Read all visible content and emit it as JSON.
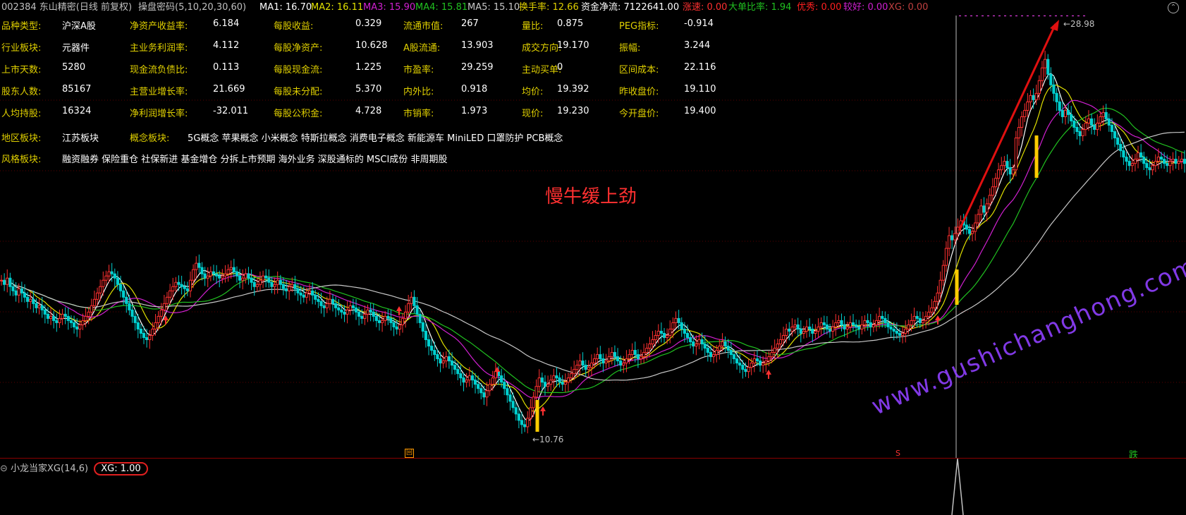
{
  "header": {
    "stock": "002384 东山精密(日线 前复权)",
    "indicator_name": "操盘密码(5,10,20,30,60)",
    "ma1": "MA1: 16.70",
    "ma2": "MA2: 16.11",
    "ma3": "MA3: 15.90",
    "ma4": "MA4: 15.81",
    "ma5": "MA5: 15.10",
    "turnover": "换手率: 12.66",
    "fund_flow": "资金净流: 7122641.00",
    "speed": "涨速: 0.00",
    "big_ratio": "大单比率: 1.94",
    "excellent": "优秀: 0.00",
    "good": "较好: 0.00",
    "xg": "XG: 0.00"
  },
  "info_rows": [
    [
      {
        "label": "品种类型:",
        "value": "沪深A股"
      },
      {
        "label": "净资产收益率:",
        "value": "6.184"
      },
      {
        "label": "每股收益:",
        "value": "0.329"
      },
      {
        "label": "流通市值:",
        "value": "267"
      },
      {
        "label": "量比:",
        "value": "0.875"
      },
      {
        "label": "PEG指标:",
        "value": "-0.914"
      }
    ],
    [
      {
        "label": "行业板块:",
        "value": "元器件"
      },
      {
        "label": "主业务利润率:",
        "value": "4.112"
      },
      {
        "label": "每股净资产:",
        "value": "10.628"
      },
      {
        "label": "A股流通:",
        "value": "13.903"
      },
      {
        "label": "成交方向:",
        "value": "19.170"
      },
      {
        "label": "振幅:",
        "value": "3.244"
      }
    ],
    [
      {
        "label": "上市天数:",
        "value": "5280"
      },
      {
        "label": "现金流负债比:",
        "value": "0.113"
      },
      {
        "label": "每股现金流:",
        "value": "1.225"
      },
      {
        "label": "市盈率:",
        "value": "29.259"
      },
      {
        "label": "主动买单:",
        "value": "0"
      },
      {
        "label": "区间成本:",
        "value": "22.116"
      }
    ],
    [
      {
        "label": "股东人数:",
        "value": "85167"
      },
      {
        "label": "主营业增长率:",
        "value": "21.669"
      },
      {
        "label": "每股未分配:",
        "value": "5.370"
      },
      {
        "label": "内外比:",
        "value": "0.918"
      },
      {
        "label": "均价:",
        "value": "19.392"
      },
      {
        "label": "昨收盘价:",
        "value": "19.110"
      }
    ],
    [
      {
        "label": "人均持股:",
        "value": "16324"
      },
      {
        "label": "净利润增长率:",
        "value": "-32.011"
      },
      {
        "label": "每股公积金:",
        "value": "4.728"
      },
      {
        "label": "市销率:",
        "value": "1.973"
      },
      {
        "label": "现价:",
        "value": "19.230"
      },
      {
        "label": "今开盘价:",
        "value": "19.400"
      }
    ]
  ],
  "region": {
    "label": "地区板块:",
    "value": "江苏板块",
    "concept_label": "概念板块:",
    "concept_value": "5G概念 苹果概念 小米概念 特斯拉概念 消费电子概念 新能源车 MiniLED 口罩防护 PCB概念"
  },
  "style": {
    "label": "风格板块:",
    "value": "融资融券 保险重仓 社保新进 基金增仓 分拆上市预期 海外业务 深股通标的 MSCI成份 非周期股"
  },
  "annotation": "慢牛缓上劲",
  "price_high": "28.98",
  "price_low": "10.76",
  "sub_indicator": {
    "name": "小龙当家XG(14,6)",
    "xg": "XG: 1.00"
  },
  "watermark": "www.gushichanghong.com",
  "bottom_markers": {
    "left": "回",
    "mid": "S",
    "right": "跌"
  },
  "colors": {
    "up": "#ff3030",
    "down": "#00d0d0",
    "ma1": "#ffffff",
    "ma2": "#e0e000",
    "ma3": "#d020d0",
    "ma4": "#20c020",
    "ma5": "#c8c8c8",
    "highlight": "#ffcc00"
  },
  "chart_data": {
    "type": "candlestick",
    "ylim": [
      10,
      30
    ],
    "x": [
      0,
      1,
      2,
      3,
      4,
      5,
      6,
      7,
      8,
      9,
      10,
      11,
      12,
      13,
      14,
      15,
      16,
      17,
      18,
      19,
      20,
      21,
      22,
      23,
      24,
      25,
      26,
      27,
      28,
      29,
      30,
      31,
      32,
      33,
      34,
      35,
      36,
      37,
      38,
      39,
      40,
      41,
      42,
      43,
      44,
      45,
      46,
      47,
      48,
      49,
      50,
      51,
      52,
      53,
      54,
      55,
      56,
      57,
      58,
      59,
      60,
      61,
      62,
      63,
      64,
      65,
      66,
      67,
      68,
      69,
      70,
      71,
      72,
      73,
      74,
      75,
      76,
      77,
      78,
      79,
      80,
      81,
      82,
      83,
      84,
      85,
      86,
      87,
      88,
      89,
      90,
      91,
      92,
      93,
      94,
      95,
      96,
      97,
      98,
      99,
      100,
      101,
      102,
      103,
      104,
      105,
      106,
      107,
      108,
      109,
      110,
      111,
      112,
      113,
      114,
      115,
      116,
      117,
      118,
      119,
      120,
      121,
      122,
      123,
      124,
      125,
      126,
      127,
      128,
      129,
      130,
      131,
      132,
      133,
      134,
      135,
      136,
      137,
      138,
      139,
      140,
      141,
      142,
      143,
      144,
      145,
      146,
      147,
      148,
      149,
      150,
      151,
      152,
      153,
      154,
      155,
      156,
      157,
      158,
      159,
      160,
      161,
      162,
      163,
      164,
      165,
      166,
      167,
      168,
      169,
      170,
      171,
      172,
      173,
      174,
      175,
      176,
      177,
      178,
      179,
      180,
      181,
      182,
      183,
      184,
      185,
      186,
      187,
      188,
      189,
      190,
      191,
      192,
      193,
      194,
      195,
      196,
      197,
      198,
      199,
      200,
      201,
      202,
      203,
      204,
      205,
      206,
      207,
      208,
      209,
      210,
      211,
      212,
      213,
      214,
      215,
      216,
      217,
      218,
      219,
      220,
      221,
      222,
      223,
      224,
      225,
      226,
      227,
      228,
      229,
      230,
      231,
      232,
      233,
      234,
      235,
      236,
      237,
      238,
      239,
      240,
      241,
      242,
      243,
      244,
      245,
      246,
      247,
      248,
      249,
      250,
      251,
      252,
      253,
      254,
      255,
      256,
      257,
      258,
      259,
      260,
      261,
      262,
      263,
      264,
      265,
      266,
      267,
      268,
      269,
      270,
      271,
      272,
      273,
      274,
      275,
      276,
      277,
      278,
      279,
      280,
      281,
      282,
      283,
      284,
      285,
      286,
      287,
      288,
      289,
      290,
      291,
      292,
      293,
      294,
      295,
      296,
      297,
      298,
      299,
      300,
      301,
      302,
      303,
      304,
      305,
      306,
      307,
      308,
      309,
      310,
      311,
      312,
      313,
      314,
      315,
      316,
      317,
      318,
      319,
      320,
      321,
      322,
      323,
      324,
      325,
      326,
      327,
      328,
      329,
      330,
      331,
      332,
      333,
      334,
      335,
      336,
      337,
      338,
      339,
      340,
      341,
      342,
      343,
      344,
      345,
      346,
      347,
      348,
      349,
      350,
      351,
      352,
      353,
      354,
      355,
      356,
      357,
      358,
      359,
      360,
      361,
      362,
      363,
      364,
      365,
      366,
      367,
      368,
      369,
      370,
      371,
      372,
      373,
      374,
      375,
      376,
      377,
      378,
      379,
      380,
      381,
      382,
      383,
      384,
      385,
      386,
      387,
      388,
      389,
      390,
      391,
      392,
      393,
      394,
      395,
      396,
      397,
      398,
      399,
      400,
      401,
      402,
      403,
      404,
      405,
      406,
      407,
      408,
      409,
      410,
      411,
      412,
      413,
      414,
      415,
      416,
      417
    ],
    "close": [
      17.8,
      17.6,
      17.9,
      17.5,
      17.3,
      17.1,
      17.4,
      17.2,
      17.0,
      16.8,
      16.9,
      16.7,
      16.5,
      16.6,
      16.4,
      16.2,
      16.0,
      16.1,
      15.9,
      15.8,
      16.0,
      16.2,
      16.1,
      15.9,
      15.8,
      15.6,
      15.5,
      15.7,
      15.9,
      16.1,
      16.3,
      16.6,
      16.9,
      17.2,
      17.5,
      17.8,
      18.0,
      18.2,
      18.1,
      17.9,
      17.6,
      17.3,
      17.0,
      16.7,
      16.4,
      16.1,
      15.8,
      15.5,
      15.3,
      15.1,
      15.0,
      15.2,
      15.5,
      15.8,
      16.1,
      16.4,
      16.7,
      17.0,
      17.3,
      17.5,
      17.7,
      17.6,
      17.5,
      17.4,
      17.3,
      17.8,
      18.3,
      18.6,
      18.4,
      18.1,
      17.9,
      18.0,
      18.2,
      18.1,
      18.0,
      17.9,
      18.0,
      18.1,
      18.3,
      18.4,
      18.2,
      18.0,
      17.8,
      17.9,
      18.1,
      17.9,
      17.7,
      17.5,
      17.6,
      17.8,
      18.0,
      17.9,
      17.7,
      17.5,
      17.6,
      17.8,
      17.6,
      17.4,
      17.3,
      17.5,
      17.6,
      17.4,
      17.2,
      17.1,
      17.0,
      17.2,
      17.3,
      17.1,
      16.9,
      16.8,
      16.6,
      16.5,
      16.7,
      16.9,
      16.7,
      16.5,
      16.4,
      16.3,
      16.2,
      16.4,
      16.6,
      16.5,
      16.3,
      16.1,
      16.0,
      16.2,
      16.4,
      16.3,
      16.1,
      15.9,
      15.8,
      15.9,
      16.1,
      16.0,
      15.8,
      15.6,
      15.5,
      15.7,
      16.0,
      16.3,
      16.7,
      17.0,
      16.6,
      16.2,
      15.8,
      15.4,
      15.0,
      14.7,
      14.5,
      14.3,
      14.1,
      13.9,
      14.0,
      14.2,
      14.0,
      13.8,
      13.6,
      13.4,
      13.2,
      13.0,
      13.1,
      13.3,
      13.1,
      12.9,
      12.7,
      12.5,
      12.3,
      12.6,
      12.9,
      13.2,
      13.5,
      13.3,
      13.0,
      12.7,
      12.4,
      12.1,
      11.8,
      11.5,
      11.2,
      11.0,
      10.9,
      11.3,
      11.8,
      12.3,
      12.8,
      13.2,
      13.0,
      12.8,
      12.9,
      13.1,
      13.3,
      13.2,
      13.0,
      12.9,
      13.0,
      13.2,
      13.4,
      13.6,
      13.8,
      14.0,
      13.8,
      13.6,
      13.7,
      13.9,
      14.1,
      14.3,
      14.1,
      13.9,
      14.0,
      14.2,
      14.4,
      14.2,
      14.0,
      13.8,
      13.9,
      14.1,
      14.3,
      14.5,
      14.3,
      14.1,
      14.2,
      14.4,
      14.6,
      14.8,
      15.0,
      15.2,
      15.4,
      15.3,
      15.1,
      15.2,
      15.5,
      15.8,
      16.0,
      15.8,
      15.5,
      15.3,
      15.1,
      14.9,
      14.7,
      14.8,
      15.0,
      14.8,
      14.6,
      14.4,
      14.2,
      14.3,
      14.5,
      14.7,
      14.9,
      14.7,
      14.5,
      14.3,
      14.1,
      13.9,
      13.8,
      13.6,
      13.5,
      13.7,
      13.9,
      14.1,
      14.0,
      13.8,
      13.9,
      14.0,
      14.2,
      14.4,
      14.6,
      14.8,
      15.0,
      15.2,
      15.5,
      15.4,
      15.6,
      15.7,
      15.5,
      15.3,
      15.4,
      15.6,
      15.5,
      15.3,
      15.4,
      15.6,
      15.8,
      15.7,
      15.5,
      15.4,
      15.6,
      15.8,
      15.9,
      15.7,
      15.5,
      15.6,
      15.8,
      15.7,
      15.6,
      15.5,
      15.7,
      15.9,
      15.8,
      15.6,
      15.7,
      15.9,
      16.1,
      16.0,
      15.8,
      15.6,
      15.5,
      15.4,
      15.3,
      15.2,
      15.3,
      15.5,
      15.7,
      15.9,
      16.1,
      16.0,
      15.8,
      15.9,
      16.1,
      16.3,
      16.5,
      16.8,
      17.2,
      17.8,
      18.5,
      19.3,
      19.9,
      19.7,
      20.0,
      20.3,
      20.6,
      20.4,
      20.2,
      20.0,
      20.1,
      20.5,
      20.9,
      21.3,
      21.0,
      21.4,
      21.8,
      22.2,
      22.6,
      23.0,
      23.2,
      23.4,
      23.1,
      22.8,
      23.0,
      24.5,
      25.0,
      25.5,
      25.8,
      26.2,
      26.5,
      26.3,
      26.6,
      27.2,
      27.8,
      28.2,
      27.5,
      27.0,
      26.6,
      26.2,
      25.8,
      25.5,
      25.8,
      25.6,
      25.3,
      25.0,
      24.8,
      24.6,
      24.9,
      25.2,
      25.4,
      25.1,
      24.9,
      25.2,
      25.5,
      25.7,
      25.4,
      25.1,
      24.8,
      24.5,
      24.2,
      23.9,
      23.6,
      23.4,
      23.2,
      23.3,
      23.5,
      23.8,
      23.6,
      23.3,
      23.1,
      23.0,
      23.2,
      23.4,
      23.6,
      23.5,
      23.3,
      23.2,
      23.4,
      23.5,
      23.3,
      23.4,
      23.5,
      23.3
    ]
  }
}
